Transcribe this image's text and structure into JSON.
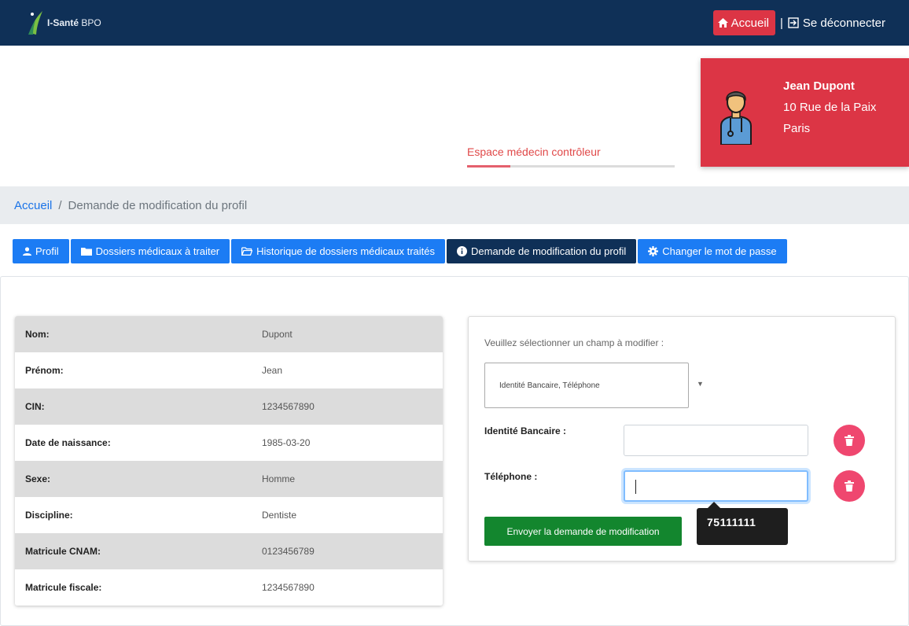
{
  "header": {
    "brand_name": "I-Santé",
    "brand_suffix": "BPO",
    "home_label": "Accueil",
    "separator": "|",
    "logout_label": "Se déconnecter",
    "background_color": "#0f3057"
  },
  "hero": {
    "space_label": "Espace médecin contrôleur"
  },
  "profile_card": {
    "name": "Jean Dupont",
    "address_line": "10 Rue de la Paix",
    "city": "Paris",
    "avatar_icon": "doctor-avatar-icon",
    "background_color": "#dc3545"
  },
  "breadcrumb": {
    "home": "Accueil",
    "separator": "/",
    "current": "Demande de modification du profil"
  },
  "tabs": [
    {
      "label": "Profil",
      "icon": "user-icon",
      "active": false
    },
    {
      "label": "Dossiers médicaux à traiter",
      "icon": "folder-icon",
      "active": false
    },
    {
      "label": "Historique de dossiers médicaux traités",
      "icon": "folder-open-icon",
      "active": false
    },
    {
      "label": "Demande de modification du profil",
      "icon": "info-circle-icon",
      "active": true
    },
    {
      "label": "Changer le mot de passe",
      "icon": "gear-icon",
      "active": false
    }
  ],
  "profile_table": [
    {
      "label": "Nom:",
      "value": "Dupont"
    },
    {
      "label": "Prénom:",
      "value": "Jean"
    },
    {
      "label": "CIN:",
      "value": "1234567890"
    },
    {
      "label": "Date de naissance:",
      "value": "1985-03-20"
    },
    {
      "label": "Sexe:",
      "value": "Homme"
    },
    {
      "label": "Discipline:",
      "value": "Dentiste"
    },
    {
      "label": "Matricule CNAM:",
      "value": "0123456789"
    },
    {
      "label": "Matricule fiscale:",
      "value": "1234567890"
    }
  ],
  "form": {
    "prompt": "Veuillez sélectionner un champ à modifier :",
    "selected_fields": "Identité Bancaire, Téléphone",
    "fields": [
      {
        "label": "Identité Bancaire :",
        "value": ""
      },
      {
        "label": "Téléphone :",
        "value": ""
      }
    ],
    "submit_label": "Envoyer la demande de modification",
    "tooltip_value": "75111111",
    "delete_icon": "trash-icon"
  },
  "colors": {
    "tab_blue": "#1c7cf4",
    "tab_active": "#0f3057",
    "submit_green": "#13862e",
    "delete_pink": "#ef476f"
  }
}
